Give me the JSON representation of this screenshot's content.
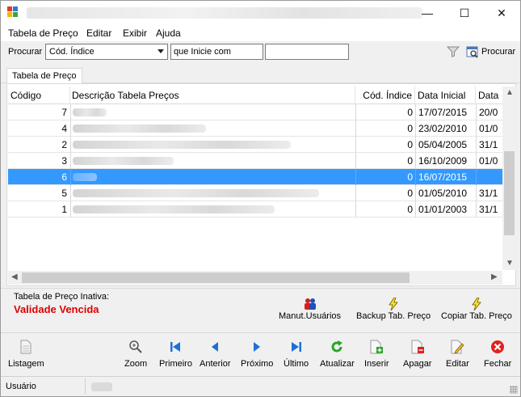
{
  "window": {
    "minimize_glyph": "—",
    "maximize_glyph": "☐",
    "close_glyph": "✕"
  },
  "menu": [
    "Tabela de Preço",
    "Editar",
    "Exibir",
    "Ajuda"
  ],
  "search": {
    "label": "Procurar",
    "field_value": "Cód. Índice",
    "condition_value": "que Inicie com",
    "search_value": "",
    "button_label": "Procurar"
  },
  "tab": {
    "label": "Tabela de Preço"
  },
  "grid": {
    "columns": [
      "Código",
      "Descrição Tabela Preços",
      "Cód. Índice",
      "Data Inicial",
      "Data"
    ],
    "rows": [
      {
        "codigo": "7",
        "indice": "0",
        "data_inicial": "17/07/2015",
        "data": "20/0",
        "selected": false
      },
      {
        "codigo": "4",
        "indice": "0",
        "data_inicial": "23/02/2010",
        "data": "01/0",
        "selected": false
      },
      {
        "codigo": "2",
        "indice": "0",
        "data_inicial": "05/04/2005",
        "data": "31/1",
        "selected": false
      },
      {
        "codigo": "3",
        "indice": "0",
        "data_inicial": "16/10/2009",
        "data": "01/0",
        "selected": false
      },
      {
        "codigo": "6",
        "indice": "0",
        "data_inicial": "16/07/2015",
        "data": "",
        "selected": true
      },
      {
        "codigo": "5",
        "indice": "0",
        "data_inicial": "01/05/2010",
        "data": "31/1",
        "selected": false
      },
      {
        "codigo": "1",
        "indice": "0",
        "data_inicial": "01/01/2003",
        "data": "31/1",
        "selected": false
      }
    ]
  },
  "info": {
    "inativa_label": "Tabela de Preço Inativa:",
    "validade_text": "Validade Vencida",
    "validade_color": "#e00000",
    "buttons": [
      "Manut.Usuários",
      "Backup Tab. Preço",
      "Copiar Tab. Preço"
    ]
  },
  "toolbar": {
    "listagem": "Listagem",
    "zoom": "Zoom",
    "primeiro": "Primeiro",
    "anterior": "Anterior",
    "proximo": "Próximo",
    "ultimo": "Último",
    "atualizar": "Atualizar",
    "inserir": "Inserir",
    "apagar": "Apagar",
    "editar": "Editar",
    "fechar": "Fechar"
  },
  "status": {
    "user_label": "Usuário"
  },
  "colors": {
    "selection": "#3399ff",
    "nav_blue": "#1e6fd9",
    "refresh_green": "#2aa52a",
    "close_red": "#e02020"
  }
}
